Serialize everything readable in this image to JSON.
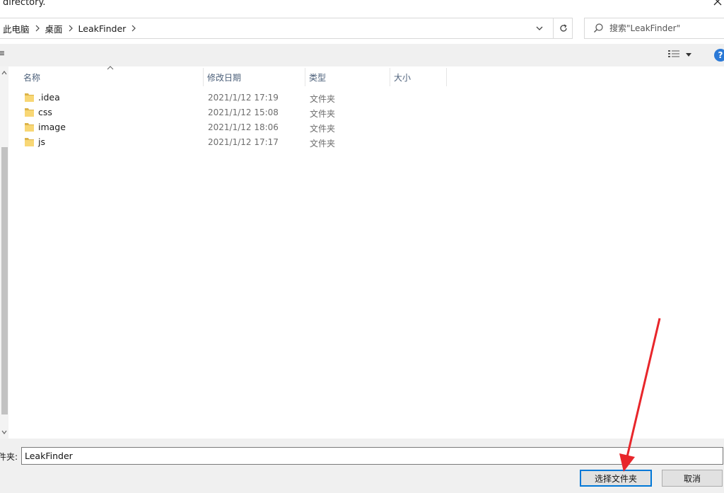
{
  "window": {
    "title": "directory."
  },
  "breadcrumb": [
    "此电脑",
    "桌面",
    "LeakFinder"
  ],
  "search": {
    "placeholder": "搜索\"LeakFinder\""
  },
  "toolbar": {
    "left_fragment": "≡"
  },
  "columns": {
    "name": "名称",
    "date": "修改日期",
    "type": "类型",
    "size": "大小"
  },
  "files": [
    {
      "name": ".idea",
      "date": "2021/1/12 17:19",
      "type": "文件夹"
    },
    {
      "name": "css",
      "date": "2021/1/12 15:08",
      "type": "文件夹"
    },
    {
      "name": "image",
      "date": "2021/1/12 18:06",
      "type": "文件夹"
    },
    {
      "name": "js",
      "date": "2021/1/12 17:17",
      "type": "文件夹"
    }
  ],
  "footer": {
    "folder_label": "件夹:",
    "folder_value": "LeakFinder",
    "select_button": "选择文件夹",
    "cancel_button": "取消"
  },
  "help": {
    "label": "?"
  },
  "colors": {
    "accent": "#0078d7",
    "folder": "#f8d775",
    "annotation": "#e8262b"
  }
}
